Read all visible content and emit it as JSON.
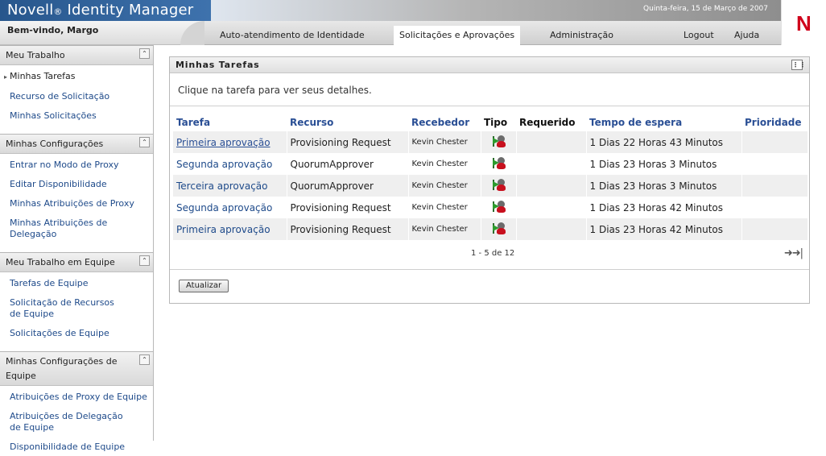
{
  "header": {
    "brand": "Novell",
    "brand_reg": "®",
    "brand_product": "Identity Manager",
    "date": "Quinta-feira, 15 de Março de 2007",
    "welcome": "Bem-vindo, Margo",
    "logo": "N",
    "nav": [
      {
        "label": "Auto-atendimento de Identidade",
        "active": false
      },
      {
        "label": "Solicitações e Aprovações",
        "active": true
      },
      {
        "label": "Administração",
        "active": false
      },
      {
        "label": "Logout",
        "active": false
      },
      {
        "label": "Ajuda",
        "active": false
      }
    ]
  },
  "sidebar": {
    "sections": [
      {
        "title": "Meu Trabalho",
        "items": [
          "Minhas Tarefas",
          "Recurso de Solicitação",
          "Minhas Solicitações"
        ]
      },
      {
        "title": "Minhas Configurações",
        "items": [
          "Entrar no Modo de Proxy",
          "Editar Disponibilidade",
          "Minhas Atribuições de Proxy",
          "Minhas Atribuições de Delegação"
        ]
      },
      {
        "title": "Meu Trabalho em Equipe",
        "items": [
          "Tarefas de Equipe",
          "Solicitação de Recursos de Equipe",
          "Solicitações de Equipe"
        ]
      },
      {
        "title": "Minhas Configurações de Equipe",
        "items": [
          "Atribuições de Proxy de Equipe",
          "Atribuições de Delegação de Equipe",
          "Disponibilidade de Equipe"
        ]
      }
    ]
  },
  "panel": {
    "title": "Minhas Tarefas",
    "intro": "Clique na tarefa para ver seus detalhes.",
    "columns": {
      "task": "Tarefa",
      "resource": "Recurso",
      "recipient": "Recebedor",
      "type": "Tipo",
      "required": "Requerido",
      "wait": "Tempo de espera",
      "priority": "Prioridade"
    },
    "rows": [
      {
        "task": "Primeira aprovação",
        "resource": "Provisioning Request",
        "recipient": "Kevin Chester",
        "required": "",
        "wait": "1 Dias 22 Horas 43 Minutos",
        "priority": ""
      },
      {
        "task": "Segunda aprovação",
        "resource": "QuorumApprover",
        "recipient": "Kevin Chester",
        "required": "",
        "wait": "1 Dias 23 Horas 3 Minutos",
        "priority": ""
      },
      {
        "task": "Terceira aprovação",
        "resource": "QuorumApprover",
        "recipient": "Kevin Chester",
        "required": "",
        "wait": "1 Dias 23 Horas 3 Minutos",
        "priority": ""
      },
      {
        "task": "Segunda aprovação",
        "resource": "Provisioning Request",
        "recipient": "Kevin Chester",
        "required": "",
        "wait": "1 Dias 23 Horas 42 Minutos",
        "priority": ""
      },
      {
        "task": "Primeira aprovação",
        "resource": "Provisioning Request",
        "recipient": "Kevin Chester",
        "required": "",
        "wait": "1 Dias 23 Horas 42 Minutos",
        "priority": ""
      }
    ],
    "pager": "1 - 5 de 12",
    "refresh_label": "Atualizar"
  },
  "icons": {
    "type": "approval-flag-person-icon",
    "next": "arrow-right-icon",
    "last": "arrow-last-icon",
    "collapse": "collapse-up-icon",
    "panel_menu": "grid-menu-icon"
  }
}
